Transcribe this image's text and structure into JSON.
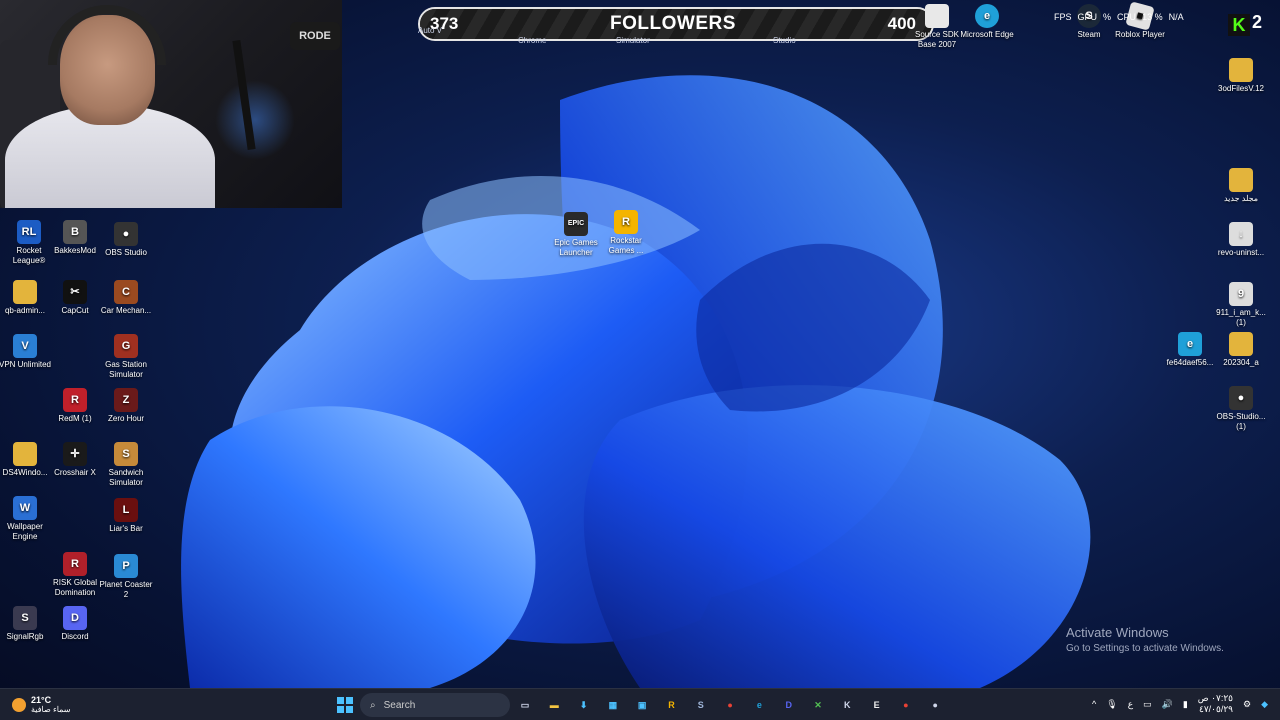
{
  "webcam": {
    "mic_brand": "RODE"
  },
  "followers_bar": {
    "current": "373",
    "title": "FOLLOWERS",
    "goal": "400"
  },
  "top_ghost_labels": [
    "Auto V",
    "Chrome",
    "Simulator",
    "Studio"
  ],
  "top_icons": [
    {
      "label": "Source SDK Base 2007",
      "color": "#e8e8e8"
    },
    {
      "label": "Microsoft Edge",
      "color": "#1fa0d8"
    },
    {
      "label": "Steam",
      "color": "#1b2838"
    },
    {
      "label": "Roblox Player",
      "color": "#e2e2e2"
    }
  ],
  "overlay_stats": {
    "fps": "FPS",
    "gpu": "GPU",
    "gpu_val": "%",
    "cpu": "CPU",
    "cpu_val": "13 %",
    "na": "N/A"
  },
  "kick": {
    "logo": "K",
    "count": "2"
  },
  "desktop_left": [
    {
      "label": "Rocket League®",
      "glyph": "RL",
      "color": "#1c5cc4"
    },
    {
      "label": "BakkesMod",
      "glyph": "B",
      "color": "#555"
    },
    {
      "label": "OBS Studio",
      "glyph": "●",
      "color": "#333"
    },
    {
      "label": "qb-admin...",
      "glyph": "",
      "color": "#e3b43c"
    },
    {
      "label": "CapCut",
      "glyph": "✂",
      "color": "#111"
    },
    {
      "label": "Car Mechan...",
      "glyph": "C",
      "color": "#9a4a20"
    },
    {
      "label": "VPN Unlimited",
      "glyph": "V",
      "color": "#2a7fd4"
    },
    {
      "label": "Gas Station Simulator",
      "glyph": "G",
      "color": "#a03020"
    },
    {
      "label": "RedM (1)",
      "glyph": "R",
      "color": "#c0202a"
    },
    {
      "label": "Zero Hour",
      "glyph": "Z",
      "color": "#6a1a1a"
    },
    {
      "label": "DS4Windo...",
      "glyph": "",
      "color": "#e3b43c"
    },
    {
      "label": "Crosshair X",
      "glyph": "✛",
      "color": "#1a1a1a"
    },
    {
      "label": "Sandwich Simulator",
      "glyph": "S",
      "color": "#c68a3a"
    },
    {
      "label": "Wallpaper Engine",
      "glyph": "W",
      "color": "#2a6fd4"
    },
    {
      "label": "Liar's Bar",
      "glyph": "L",
      "color": "#6a0f0f"
    },
    {
      "label": "RISK Global Domination",
      "glyph": "R",
      "color": "#b0202a"
    },
    {
      "label": "Planet Coaster 2",
      "glyph": "P",
      "color": "#2a8ad4"
    },
    {
      "label": "SignalRgb",
      "glyph": "S",
      "color": "#3a3a50"
    },
    {
      "label": "Discord",
      "glyph": "D",
      "color": "#5865f2"
    }
  ],
  "desktop_center": [
    {
      "label": "Epic Games Launcher",
      "glyph": "EPIC",
      "color": "#2a2a2a"
    },
    {
      "label": "Rockstar Games ...",
      "glyph": "R",
      "color": "#f4b400"
    }
  ],
  "desktop_right": [
    {
      "label": "3odFilesV.12",
      "glyph": "",
      "color": "#e3b43c"
    },
    {
      "label": "مجلد جديد",
      "glyph": "",
      "color": "#e3b43c"
    },
    {
      "label": "revo-uninst...",
      "glyph": "↓",
      "color": "#ddd"
    },
    {
      "label": "911_i_am_k... (1)",
      "glyph": "9",
      "color": "#ddd"
    },
    {
      "label": "fe64daef56...",
      "glyph": "e",
      "color": "#1fa0d8"
    },
    {
      "label": "202304_a",
      "glyph": "",
      "color": "#e3b43c"
    },
    {
      "label": "OBS-Studio... (1)",
      "glyph": "●",
      "color": "#333"
    }
  ],
  "activation": {
    "title": "Activate Windows",
    "subtitle": "Go to Settings to activate Windows."
  },
  "taskbar": {
    "weather_temp": "21°C",
    "weather_desc": "سماء صافية",
    "search_placeholder": "Search",
    "apps": [
      {
        "name": "task-view-icon",
        "glyph": "▭",
        "color": "#cfd6ea"
      },
      {
        "name": "file-explorer-icon",
        "glyph": "▬",
        "color": "#f4c542"
      },
      {
        "name": "download-icon",
        "glyph": "⬇",
        "color": "#4cc2ff"
      },
      {
        "name": "store-icon",
        "glyph": "▦",
        "color": "#4cc2ff"
      },
      {
        "name": "window-icon",
        "glyph": "▣",
        "color": "#4cc2ff"
      },
      {
        "name": "rockstar-icon",
        "glyph": "R",
        "color": "#f4b400"
      },
      {
        "name": "steam-icon",
        "glyph": "S",
        "color": "#9fb5d8"
      },
      {
        "name": "chrome-icon",
        "glyph": "●",
        "color": "#e94235"
      },
      {
        "name": "edge-icon",
        "glyph": "e",
        "color": "#1fa0d8"
      },
      {
        "name": "discord-icon",
        "glyph": "D",
        "color": "#5865f2"
      },
      {
        "name": "xbox-icon",
        "glyph": "✕",
        "color": "#53c153"
      },
      {
        "name": "kick-icon",
        "glyph": "K",
        "color": "#cfd6ea"
      },
      {
        "name": "epic-icon",
        "glyph": "E",
        "color": "#eee"
      },
      {
        "name": "chrome-2-icon",
        "glyph": "●",
        "color": "#e94235"
      },
      {
        "name": "obs-icon",
        "glyph": "●",
        "color": "#cfd6ea"
      }
    ],
    "lang": "ع",
    "time": "٠٧:٢٥ ص",
    "date": "٤٧/٠٥/٢٩"
  }
}
